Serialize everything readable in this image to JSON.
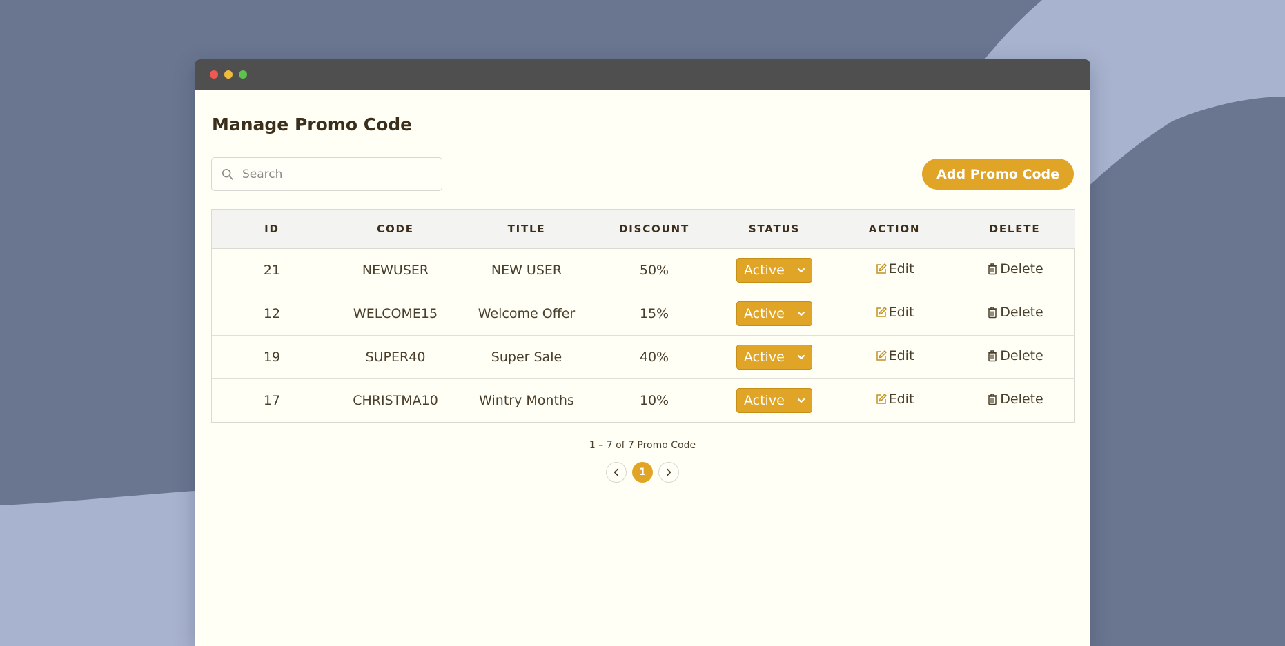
{
  "colors": {
    "accent": "#e0a526",
    "background": "#6a7690",
    "background_shape": "#a8b3cf",
    "titlebar": "#4f4f4f",
    "window": "#fffff6"
  },
  "page": {
    "title": "Manage Promo Code"
  },
  "search": {
    "placeholder": "Search",
    "value": "",
    "icon": "search-icon"
  },
  "toolbar": {
    "add_label": "Add Promo Code"
  },
  "table": {
    "headers": {
      "id": "ID",
      "code": "CODE",
      "title": "TITLE",
      "discount": "DISCOUNT",
      "status": "STATUS",
      "action": "ACTION",
      "delete": "DELETE"
    },
    "rows": [
      {
        "id": "21",
        "code": "NEWUSER",
        "title": "NEW USER",
        "discount": "50%",
        "status": "Active",
        "edit": "Edit",
        "delete": "Delete"
      },
      {
        "id": "12",
        "code": "WELCOME15",
        "title": "Welcome Offer",
        "discount": "15%",
        "status": "Active",
        "edit": "Edit",
        "delete": "Delete"
      },
      {
        "id": "19",
        "code": "SUPER40",
        "title": "Super Sale",
        "discount": "40%",
        "status": "Active",
        "edit": "Edit",
        "delete": "Delete"
      },
      {
        "id": "17",
        "code": "CHRISTMA10",
        "title": "Wintry Months",
        "discount": "10%",
        "status": "Active",
        "edit": "Edit",
        "delete": "Delete"
      }
    ]
  },
  "pagination": {
    "summary": "1 – 7 of 7 Promo Code",
    "current_page": "1"
  }
}
